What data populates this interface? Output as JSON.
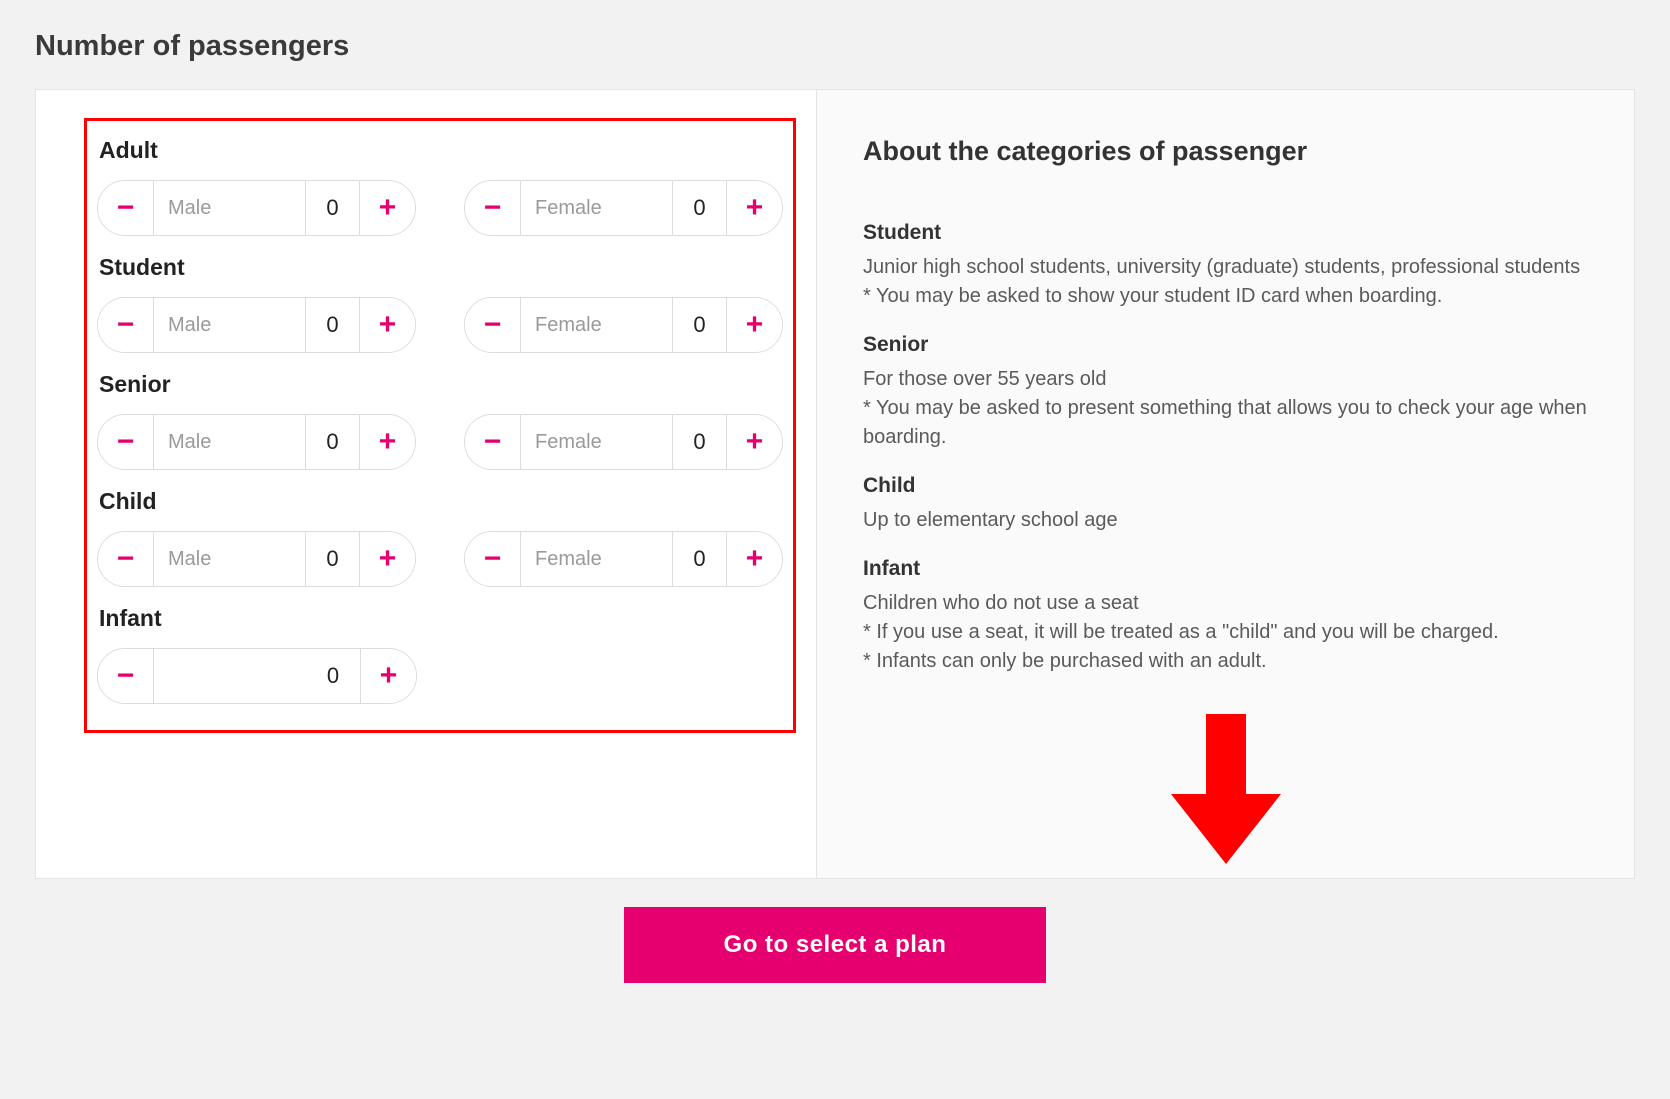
{
  "page": {
    "title": "Number of passengers"
  },
  "labels": {
    "male": "Male",
    "female": "Female"
  },
  "categories": {
    "adult": {
      "title": "Adult",
      "male": 0,
      "female": 0
    },
    "student": {
      "title": "Student",
      "male": 0,
      "female": 0
    },
    "senior": {
      "title": "Senior",
      "male": 0,
      "female": 0
    },
    "child": {
      "title": "Child",
      "male": 0,
      "female": 0
    },
    "infant": {
      "title": "Infant",
      "value": 0
    }
  },
  "info": {
    "title": "About the categories of passenger",
    "student": {
      "head": "Student",
      "body": "Junior high school students, university (graduate) students, professional students\n* You may be asked to show your student ID card when boarding."
    },
    "senior": {
      "head": "Senior",
      "body": "For those over 55 years old\n* You may be asked to present something that allows you to check your age when boarding."
    },
    "child": {
      "head": "Child",
      "body": "Up to elementary school age"
    },
    "infant": {
      "head": "Infant",
      "body": "Children who do not use a seat\n* If you use a seat, it will be treated as a \"child\" and you will be charged.\n* Infants can only be purchased with an adult."
    }
  },
  "cta": {
    "label": "Go to select a plan"
  },
  "colors": {
    "accent": "#e6006f",
    "highlight": "#ff0000"
  }
}
